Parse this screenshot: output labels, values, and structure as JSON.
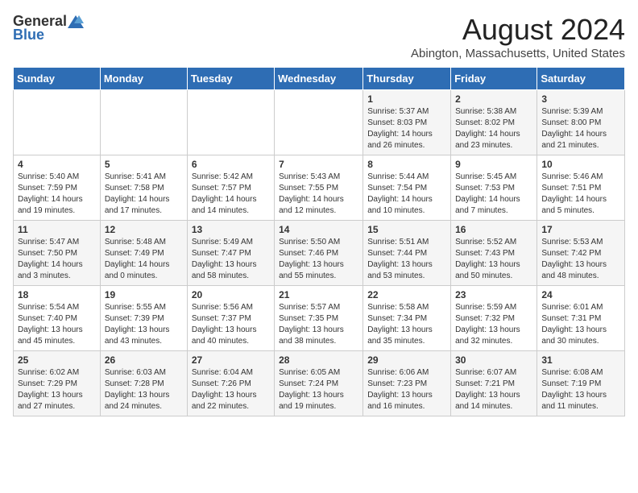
{
  "logo": {
    "general": "General",
    "blue": "Blue"
  },
  "title": "August 2024",
  "location": "Abington, Massachusetts, United States",
  "headers": [
    "Sunday",
    "Monday",
    "Tuesday",
    "Wednesday",
    "Thursday",
    "Friday",
    "Saturday"
  ],
  "weeks": [
    [
      {
        "day": "",
        "info": ""
      },
      {
        "day": "",
        "info": ""
      },
      {
        "day": "",
        "info": ""
      },
      {
        "day": "",
        "info": ""
      },
      {
        "day": "1",
        "info": "Sunrise: 5:37 AM\nSunset: 8:03 PM\nDaylight: 14 hours\nand 26 minutes."
      },
      {
        "day": "2",
        "info": "Sunrise: 5:38 AM\nSunset: 8:02 PM\nDaylight: 14 hours\nand 23 minutes."
      },
      {
        "day": "3",
        "info": "Sunrise: 5:39 AM\nSunset: 8:00 PM\nDaylight: 14 hours\nand 21 minutes."
      }
    ],
    [
      {
        "day": "4",
        "info": "Sunrise: 5:40 AM\nSunset: 7:59 PM\nDaylight: 14 hours\nand 19 minutes."
      },
      {
        "day": "5",
        "info": "Sunrise: 5:41 AM\nSunset: 7:58 PM\nDaylight: 14 hours\nand 17 minutes."
      },
      {
        "day": "6",
        "info": "Sunrise: 5:42 AM\nSunset: 7:57 PM\nDaylight: 14 hours\nand 14 minutes."
      },
      {
        "day": "7",
        "info": "Sunrise: 5:43 AM\nSunset: 7:55 PM\nDaylight: 14 hours\nand 12 minutes."
      },
      {
        "day": "8",
        "info": "Sunrise: 5:44 AM\nSunset: 7:54 PM\nDaylight: 14 hours\nand 10 minutes."
      },
      {
        "day": "9",
        "info": "Sunrise: 5:45 AM\nSunset: 7:53 PM\nDaylight: 14 hours\nand 7 minutes."
      },
      {
        "day": "10",
        "info": "Sunrise: 5:46 AM\nSunset: 7:51 PM\nDaylight: 14 hours\nand 5 minutes."
      }
    ],
    [
      {
        "day": "11",
        "info": "Sunrise: 5:47 AM\nSunset: 7:50 PM\nDaylight: 14 hours\nand 3 minutes."
      },
      {
        "day": "12",
        "info": "Sunrise: 5:48 AM\nSunset: 7:49 PM\nDaylight: 14 hours\nand 0 minutes."
      },
      {
        "day": "13",
        "info": "Sunrise: 5:49 AM\nSunset: 7:47 PM\nDaylight: 13 hours\nand 58 minutes."
      },
      {
        "day": "14",
        "info": "Sunrise: 5:50 AM\nSunset: 7:46 PM\nDaylight: 13 hours\nand 55 minutes."
      },
      {
        "day": "15",
        "info": "Sunrise: 5:51 AM\nSunset: 7:44 PM\nDaylight: 13 hours\nand 53 minutes."
      },
      {
        "day": "16",
        "info": "Sunrise: 5:52 AM\nSunset: 7:43 PM\nDaylight: 13 hours\nand 50 minutes."
      },
      {
        "day": "17",
        "info": "Sunrise: 5:53 AM\nSunset: 7:42 PM\nDaylight: 13 hours\nand 48 minutes."
      }
    ],
    [
      {
        "day": "18",
        "info": "Sunrise: 5:54 AM\nSunset: 7:40 PM\nDaylight: 13 hours\nand 45 minutes."
      },
      {
        "day": "19",
        "info": "Sunrise: 5:55 AM\nSunset: 7:39 PM\nDaylight: 13 hours\nand 43 minutes."
      },
      {
        "day": "20",
        "info": "Sunrise: 5:56 AM\nSunset: 7:37 PM\nDaylight: 13 hours\nand 40 minutes."
      },
      {
        "day": "21",
        "info": "Sunrise: 5:57 AM\nSunset: 7:35 PM\nDaylight: 13 hours\nand 38 minutes."
      },
      {
        "day": "22",
        "info": "Sunrise: 5:58 AM\nSunset: 7:34 PM\nDaylight: 13 hours\nand 35 minutes."
      },
      {
        "day": "23",
        "info": "Sunrise: 5:59 AM\nSunset: 7:32 PM\nDaylight: 13 hours\nand 32 minutes."
      },
      {
        "day": "24",
        "info": "Sunrise: 6:01 AM\nSunset: 7:31 PM\nDaylight: 13 hours\nand 30 minutes."
      }
    ],
    [
      {
        "day": "25",
        "info": "Sunrise: 6:02 AM\nSunset: 7:29 PM\nDaylight: 13 hours\nand 27 minutes."
      },
      {
        "day": "26",
        "info": "Sunrise: 6:03 AM\nSunset: 7:28 PM\nDaylight: 13 hours\nand 24 minutes."
      },
      {
        "day": "27",
        "info": "Sunrise: 6:04 AM\nSunset: 7:26 PM\nDaylight: 13 hours\nand 22 minutes."
      },
      {
        "day": "28",
        "info": "Sunrise: 6:05 AM\nSunset: 7:24 PM\nDaylight: 13 hours\nand 19 minutes."
      },
      {
        "day": "29",
        "info": "Sunrise: 6:06 AM\nSunset: 7:23 PM\nDaylight: 13 hours\nand 16 minutes."
      },
      {
        "day": "30",
        "info": "Sunrise: 6:07 AM\nSunset: 7:21 PM\nDaylight: 13 hours\nand 14 minutes."
      },
      {
        "day": "31",
        "info": "Sunrise: 6:08 AM\nSunset: 7:19 PM\nDaylight: 13 hours\nand 11 minutes."
      }
    ]
  ]
}
